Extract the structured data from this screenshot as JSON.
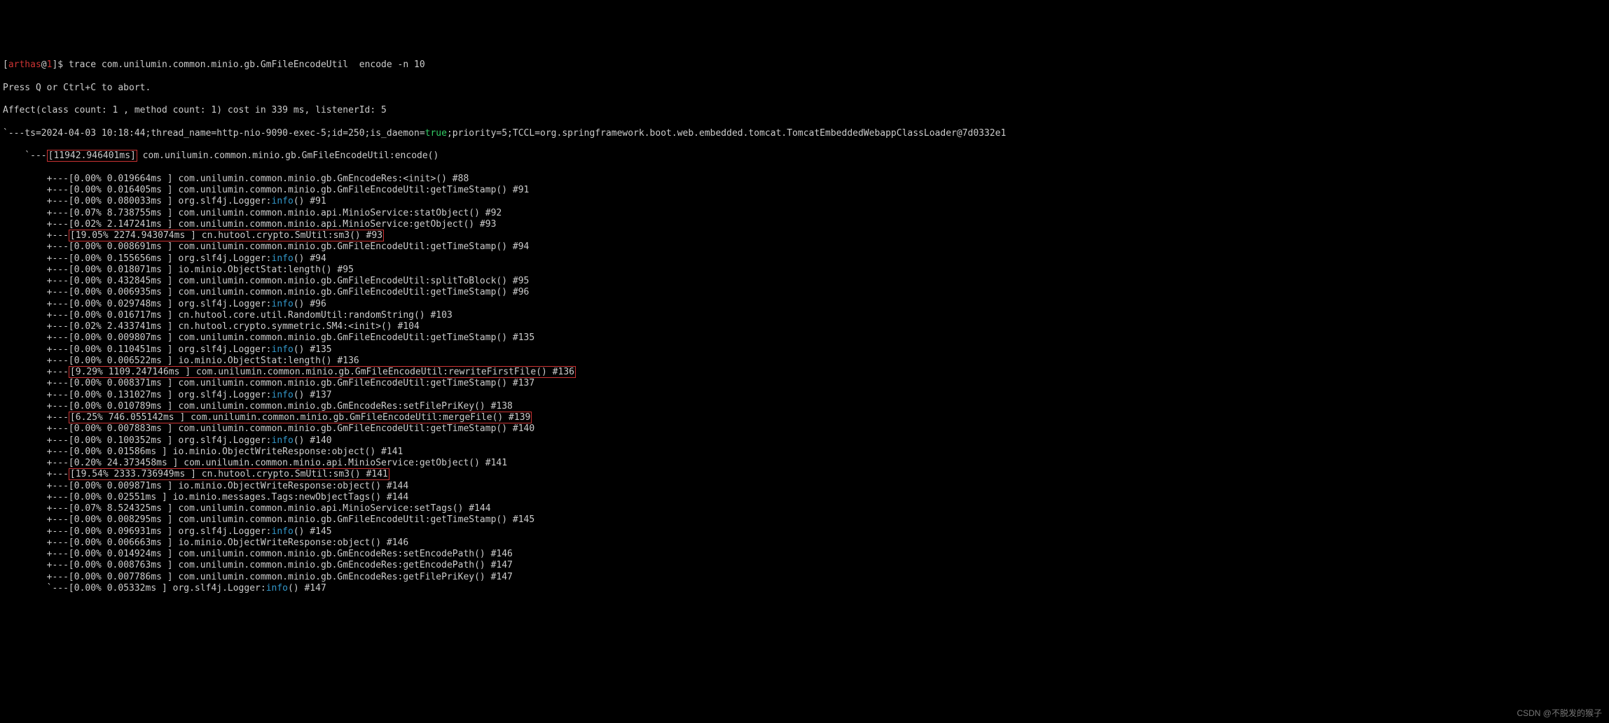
{
  "prompt": {
    "user": "arthas",
    "host": "1",
    "command": "trace com.unilumin.common.minio.gb.GmFileEncodeUtil  encode -n 10"
  },
  "abort_hint": "Press Q or Ctrl+C to abort.",
  "affect_line": "Affect(class count: 1 , method count: 1) cost in 339 ms, listenerId: 5",
  "ts_line": {
    "prefix": "`---ts=2024-04-03 10:18:44;thread_name=http-nio-9090-exec-5;id=250;is_daemon=",
    "true": "true",
    "suffix": ";priority=5;TCCL=org.springframework.boot.web.embedded.tomcat.TomcatEmbeddedWebappClassLoader@7d0332e1"
  },
  "root": {
    "prefix": "    `---",
    "hl": "[11942.946401ms]",
    "rest": " com.unilumin.common.minio.gb.GmFileEncodeUtil:encode()"
  },
  "rows": [
    {
      "p": "        +---",
      "t": "[0.00% 0.019664ms ] com.unilumin.common.minio.gb.GmEncodeRes:<init>() #88"
    },
    {
      "p": "        +---",
      "t": "[0.00% 0.016405ms ] com.unilumin.common.minio.gb.GmFileEncodeUtil:getTimeStamp() #91"
    },
    {
      "p": "        +---",
      "t": "[0.00% 0.080033ms ] org.slf4j.Logger:",
      "info": "info",
      "rest": "() #91"
    },
    {
      "p": "        +---",
      "t": "[0.07% 8.738755ms ] com.unilumin.common.minio.api.MinioService:statObject() #92"
    },
    {
      "p": "        +---",
      "t": "[0.02% 2.147241ms ] com.unilumin.common.minio.api.MinioService:getObject() #93"
    },
    {
      "p": "        +---",
      "hl": "[19.05% 2274.943074ms ] cn.hutool.crypto.SmUtil:sm3() #93"
    },
    {
      "p": "        +---",
      "t": "[0.00% 0.008691ms ] com.unilumin.common.minio.gb.GmFileEncodeUtil:getTimeStamp() #94"
    },
    {
      "p": "        +---",
      "t": "[0.00% 0.155656ms ] org.slf4j.Logger:",
      "info": "info",
      "rest": "() #94"
    },
    {
      "p": "        +---",
      "t": "[0.00% 0.018071ms ] io.minio.ObjectStat:length() #95"
    },
    {
      "p": "        +---",
      "t": "[0.00% 0.432845ms ] com.unilumin.common.minio.gb.GmFileEncodeUtil:splitToBlock() #95"
    },
    {
      "p": "        +---",
      "t": "[0.00% 0.006935ms ] com.unilumin.common.minio.gb.GmFileEncodeUtil:getTimeStamp() #96"
    },
    {
      "p": "        +---",
      "t": "[0.00% 0.029748ms ] org.slf4j.Logger:",
      "info": "info",
      "rest": "() #96"
    },
    {
      "p": "        +---",
      "t": "[0.00% 0.016717ms ] cn.hutool.core.util.RandomUtil:randomString() #103"
    },
    {
      "p": "        +---",
      "t": "[0.02% 2.433741ms ] cn.hutool.crypto.symmetric.SM4:<init>() #104"
    },
    {
      "p": "        +---",
      "t": "[0.00% 0.009807ms ] com.unilumin.common.minio.gb.GmFileEncodeUtil:getTimeStamp() #135"
    },
    {
      "p": "        +---",
      "t": "[0.00% 0.110451ms ] org.slf4j.Logger:",
      "info": "info",
      "rest": "() #135"
    },
    {
      "p": "        +---",
      "t": "[0.00% 0.006522ms ] io.minio.ObjectStat:length() #136"
    },
    {
      "p": "        +---",
      "hl": "[9.29% 1109.247146ms ] com.unilumin.common.minio.gb.GmFileEncodeUtil:rewriteFirstFile() #136"
    },
    {
      "p": "        +---",
      "t": "[0.00% 0.008371ms ] com.unilumin.common.minio.gb.GmFileEncodeUtil:getTimeStamp() #137"
    },
    {
      "p": "        +---",
      "t": "[0.00% 0.131027ms ] org.slf4j.Logger:",
      "info": "info",
      "rest": "() #137"
    },
    {
      "p": "        +---",
      "t": "[0.00% 0.010789ms ] com.unilumin.common.minio.gb.GmEncodeRes:setFilePriKey() #138"
    },
    {
      "p": "        +---",
      "hl": "[6.25% 746.055142ms ] com.unilumin.common.minio.gb.GmFileEncodeUtil:mergeFile() #139"
    },
    {
      "p": "        +---",
      "t": "[0.00% 0.007883ms ] com.unilumin.common.minio.gb.GmFileEncodeUtil:getTimeStamp() #140"
    },
    {
      "p": "        +---",
      "t": "[0.00% 0.100352ms ] org.slf4j.Logger:",
      "info": "info",
      "rest": "() #140"
    },
    {
      "p": "        +---",
      "t": "[0.00% 0.01586ms ] io.minio.ObjectWriteResponse:object() #141"
    },
    {
      "p": "        +---",
      "t": "[0.20% 24.373458ms ] com.unilumin.common.minio.api.MinioService:getObject() #141"
    },
    {
      "p": "        +---",
      "hl": "[19.54% 2333.736949ms ] cn.hutool.crypto.SmUtil:sm3() #141"
    },
    {
      "p": "        +---",
      "t": "[0.00% 0.009871ms ] io.minio.ObjectWriteResponse:object() #144"
    },
    {
      "p": "        +---",
      "t": "[0.00% 0.02551ms ] io.minio.messages.Tags:newObjectTags() #144"
    },
    {
      "p": "        +---",
      "t": "[0.07% 8.524325ms ] com.unilumin.common.minio.api.MinioService:setTags() #144"
    },
    {
      "p": "        +---",
      "t": "[0.00% 0.008295ms ] com.unilumin.common.minio.gb.GmFileEncodeUtil:getTimeStamp() #145"
    },
    {
      "p": "        +---",
      "t": "[0.00% 0.096931ms ] org.slf4j.Logger:",
      "info": "info",
      "rest": "() #145"
    },
    {
      "p": "        +---",
      "t": "[0.00% 0.006663ms ] io.minio.ObjectWriteResponse:object() #146"
    },
    {
      "p": "        +---",
      "t": "[0.00% 0.014924ms ] com.unilumin.common.minio.gb.GmEncodeRes:setEncodePath() #146"
    },
    {
      "p": "        +---",
      "t": "[0.00% 0.008763ms ] com.unilumin.common.minio.gb.GmEncodeRes:getEncodePath() #147"
    },
    {
      "p": "        +---",
      "t": "[0.00% 0.007786ms ] com.unilumin.common.minio.gb.GmEncodeRes:getFilePriKey() #147"
    },
    {
      "p": "        `---",
      "t": "[0.00% 0.05332ms ] org.slf4j.Logger:",
      "info": "info",
      "rest": "() #147"
    }
  ],
  "footer": "CSDN @不脱发的猴子"
}
